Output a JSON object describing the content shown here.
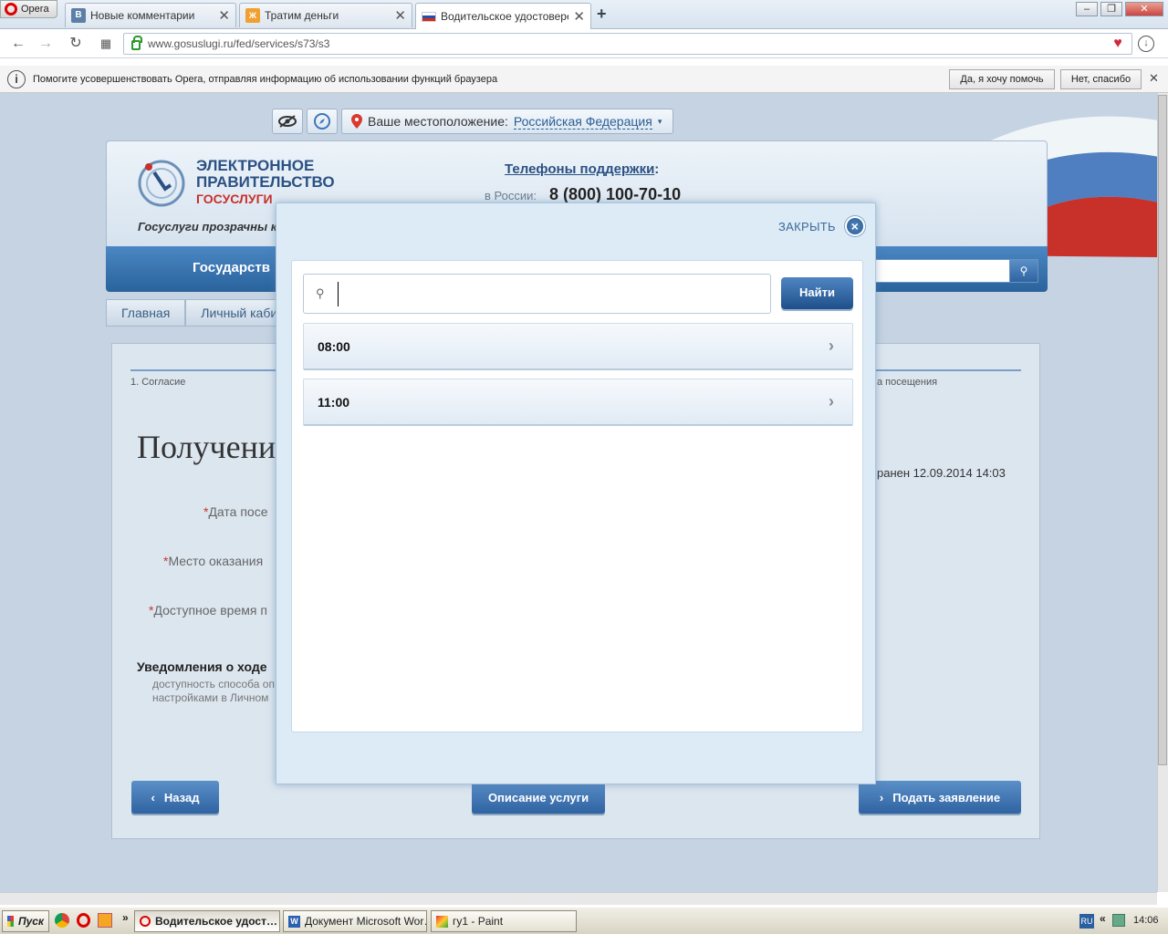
{
  "browser": {
    "menu_label": "Opera",
    "tabs": [
      {
        "label": "Новые комментарии",
        "icon": "vk-icon"
      },
      {
        "label": "Тратим деньги",
        "icon": "livejournal-icon"
      },
      {
        "label": "Водительское удостоверен",
        "icon": "russian-flag-icon",
        "active": true
      }
    ],
    "new_tab": "+",
    "url": "www.gosuslugi.ru/fed/services/s73/s3",
    "window_controls": [
      "–",
      "❐",
      "✕"
    ]
  },
  "infobar": {
    "icon": "i",
    "message": "Помогите усовершенствовать Opera, отправляя информацию об использовании функций браузера",
    "accept_label": "Да, я хочу помочь",
    "decline_label": "Нет, спасибо",
    "close": "✕"
  },
  "site": {
    "location_label": "Ваше местоположение:",
    "location_value": "Российская Федерация",
    "logo_line1": "ЭЛЕКТРОННОЕ",
    "logo_line2": "ПРАВИТЕЛЬСТВО",
    "logo_line3": "ГОСУСЛУГИ",
    "tagline": "Госуслуги прозрачны как",
    "support_label": "Телефоны поддержки",
    "support_colon": ":",
    "support_region": "в России:",
    "support_phone": "8 (800) 100-70-10",
    "nav_label": "Государств",
    "breadcrumb": [
      "Главная",
      "Личный кабинет"
    ],
    "step_first": "1. Согласие",
    "step_last": "а посещения",
    "page_title": "Получени",
    "saved_text": "ранен 12.09.2014 14:03",
    "fields": [
      "Дата посе",
      "Место оказания",
      "Доступное время п"
    ],
    "required_mark": "*",
    "notifications_title": "Уведомления о ходе",
    "notifications_line1": "доступность способа оп",
    "notifications_line2": "настройками в Личном",
    "back_label": "Назад",
    "describe_label": "Описание услуги",
    "submit_label": "Подать заявление"
  },
  "modal": {
    "close_label": "ЗАКРЫТЬ",
    "search_value": "",
    "find_label": "Найти",
    "slots": [
      "08:00",
      "11:00"
    ]
  },
  "taskbar": {
    "start_label": "Пуск",
    "chevron": "»",
    "tasks": [
      {
        "label": "Водительское удост…",
        "active": true
      },
      {
        "label": "Документ Microsoft Wor…",
        "active": false
      },
      {
        "label": "гу1 - Paint",
        "active": false
      }
    ],
    "lang": "RU",
    "tray_chevron": "«",
    "clock": "14:06"
  },
  "colors": {
    "accent": "#2f63a1",
    "page_bg": "#c5d3e2",
    "modal_bg": "#dcebf6"
  }
}
